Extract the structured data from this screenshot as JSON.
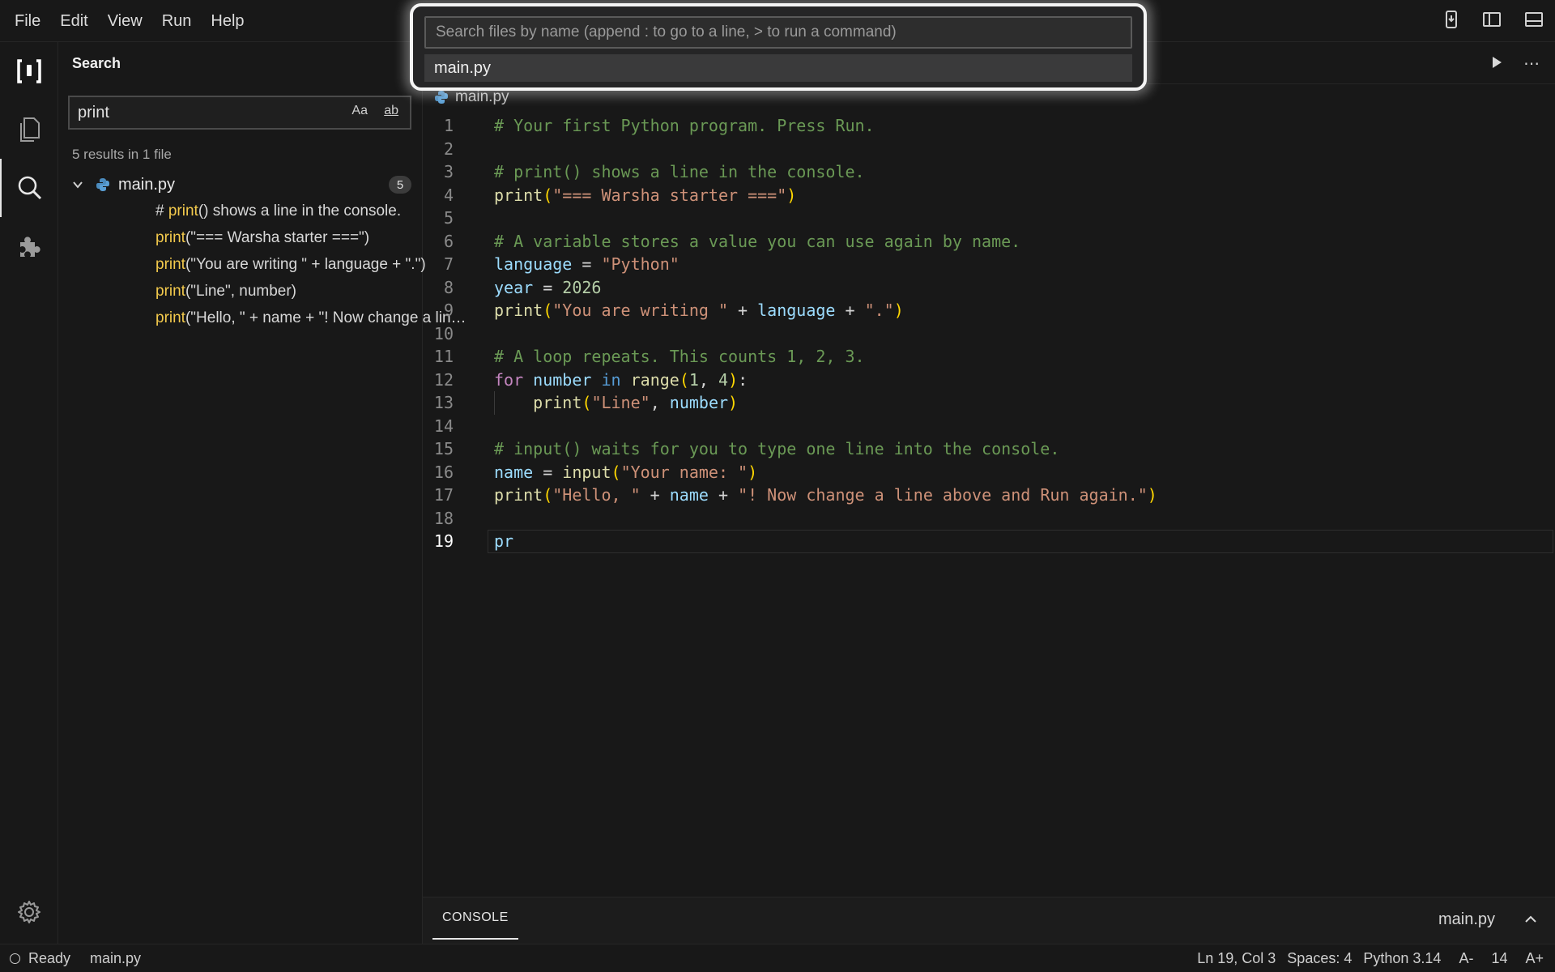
{
  "menu": [
    "File",
    "Edit",
    "View",
    "Run",
    "Help"
  ],
  "sidebar": {
    "title": "Search",
    "query": "print",
    "match_case_label": "Aa",
    "whole_word_label": "ab",
    "summary": "5 results in 1 file",
    "file": {
      "name": "main.py",
      "count": "5"
    },
    "results": [
      {
        "pre": "# ",
        "match": "print",
        "post": "() shows a line in the console."
      },
      {
        "pre": "",
        "match": "print",
        "post": "(\"=== Warsha starter ===\")"
      },
      {
        "pre": "",
        "match": "print",
        "post": "(\"You are writing \" + language + \".\")"
      },
      {
        "pre": "",
        "match": "print",
        "post": "(\"Line\", number)"
      },
      {
        "pre": "",
        "match": "print",
        "post": "(\"Hello, \" + name + \"! Now change a line above and Run again.\")"
      }
    ]
  },
  "quick_open": {
    "placeholder": "Search files by name (append : to go to a line, > to run a command)",
    "items": [
      "main.py"
    ]
  },
  "editor": {
    "breadcrumb": "main.py",
    "current_line": 19,
    "lines": [
      [
        [
          "c-com",
          "# Your first Python program. Press Run."
        ]
      ],
      [],
      [
        [
          "c-com",
          "# print() shows a line in the console."
        ]
      ],
      [
        [
          "c-fn",
          "print"
        ],
        [
          "c-p1",
          "("
        ],
        [
          "c-str",
          "\"=== Warsha starter ===\""
        ],
        [
          "c-p1",
          ")"
        ]
      ],
      [],
      [
        [
          "c-com",
          "# A variable stores a value you can use again by name."
        ]
      ],
      [
        [
          "c-var",
          "language"
        ],
        [
          "",
          " = "
        ],
        [
          "c-str",
          "\"Python\""
        ]
      ],
      [
        [
          "c-var",
          "year"
        ],
        [
          "",
          " = "
        ],
        [
          "c-num",
          "2026"
        ]
      ],
      [
        [
          "c-fn",
          "print"
        ],
        [
          "c-p1",
          "("
        ],
        [
          "c-str",
          "\"You are writing \""
        ],
        [
          "",
          " + "
        ],
        [
          "c-var",
          "language"
        ],
        [
          "",
          " + "
        ],
        [
          "c-str",
          "\".\""
        ],
        [
          "c-p1",
          ")"
        ]
      ],
      [],
      [
        [
          "c-com",
          "# A loop repeats. This counts 1, 2, 3."
        ]
      ],
      [
        [
          "c-kw",
          "for"
        ],
        [
          "",
          " "
        ],
        [
          "c-var",
          "number"
        ],
        [
          "",
          " "
        ],
        [
          "c-kw2",
          "in"
        ],
        [
          "",
          " "
        ],
        [
          "c-fn",
          "range"
        ],
        [
          "c-p1",
          "("
        ],
        [
          "c-num",
          "1"
        ],
        [
          "",
          ", "
        ],
        [
          "c-num",
          "4"
        ],
        [
          "c-p1",
          ")"
        ],
        [
          "",
          ":"
        ]
      ],
      [
        [
          "",
          "    "
        ],
        [
          "c-fn",
          "print"
        ],
        [
          "c-p1",
          "("
        ],
        [
          "c-str",
          "\"Line\""
        ],
        [
          "",
          ", "
        ],
        [
          "c-var",
          "number"
        ],
        [
          "c-p1",
          ")"
        ]
      ],
      [],
      [
        [
          "c-com",
          "# input() waits for you to type one line into the console."
        ]
      ],
      [
        [
          "c-var",
          "name"
        ],
        [
          "",
          " = "
        ],
        [
          "c-fn",
          "input"
        ],
        [
          "c-p1",
          "("
        ],
        [
          "c-str",
          "\"Your name: \""
        ],
        [
          "c-p1",
          ")"
        ]
      ],
      [
        [
          "c-fn",
          "print"
        ],
        [
          "c-p1",
          "("
        ],
        [
          "c-str",
          "\"Hello, \""
        ],
        [
          "",
          " + "
        ],
        [
          "c-var",
          "name"
        ],
        [
          "",
          " + "
        ],
        [
          "c-str",
          "\"! Now change a line above and Run again.\""
        ],
        [
          "c-p1",
          ")"
        ]
      ],
      [],
      [
        [
          "c-var",
          "pr"
        ]
      ]
    ]
  },
  "console": {
    "tab_label": "CONSOLE",
    "file": "main.py"
  },
  "status": {
    "state": "Ready",
    "file": "main.py",
    "cursor": "Ln 19, Col 3",
    "spaces": "Spaces: 4",
    "language": "Python 3.14",
    "font_decrease": "A-",
    "font_size": "14",
    "font_increase": "A+"
  }
}
